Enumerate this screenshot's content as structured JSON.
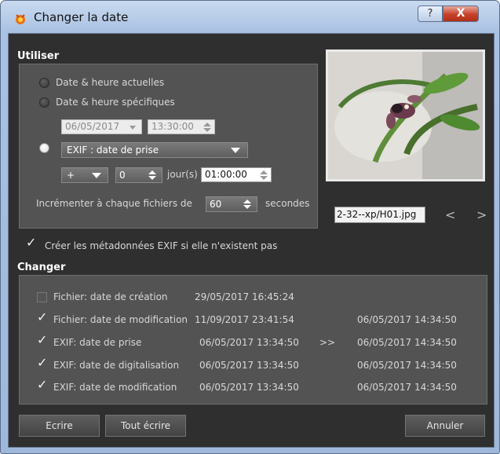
{
  "window": {
    "title": "Changer la date",
    "help_label": "?",
    "close_label": "X"
  },
  "utiliser": {
    "header": "Utiliser",
    "opt_now": "Date & heure actuelles",
    "opt_specific": "Date & heure spécifiques",
    "specific_date": "06/05/2017",
    "specific_time": "13:30:00",
    "exif_select": "EXIF : date de prise",
    "sign_select": "+",
    "days_value": "0",
    "days_label": "jour(s)",
    "offset_time": "01:00:00",
    "increment_label": "Incrémenter à chaque fichiers de",
    "increment_value": "60",
    "increment_unit": "secondes",
    "selected_option": "exif"
  },
  "preview": {
    "filename": "2-32--xp/H01.jpg",
    "prev_label": "<",
    "next_label": ">"
  },
  "create_exif": {
    "label": "Créer les métadonnées EXIF si elle n'existent pas",
    "checked": true
  },
  "changer": {
    "header": "Changer",
    "arrow": ">>",
    "rows": [
      {
        "label": "Fichier: date de création",
        "current": "29/05/2017 16:45:24",
        "new": "",
        "checked": false
      },
      {
        "label": "Fichier: date de modification",
        "current": "11/09/2017 23:41:54",
        "new": "06/05/2017 14:34:50",
        "checked": true
      },
      {
        "label": "EXIF: date de prise",
        "current": "06/05/2017 13:34:50",
        "new": "06/05/2017 14:34:50",
        "checked": true
      },
      {
        "label": "EXIF: date de digitalisation",
        "current": "06/05/2017 13:34:50",
        "new": "06/05/2017 14:34:50",
        "checked": true
      },
      {
        "label": "EXIF: date de modification",
        "current": "06/05/2017 13:34:50",
        "new": "06/05/2017 14:34:50",
        "checked": true
      }
    ]
  },
  "buttons": {
    "write": "Ecrire",
    "write_all": "Tout écrire",
    "cancel": "Annuler"
  }
}
